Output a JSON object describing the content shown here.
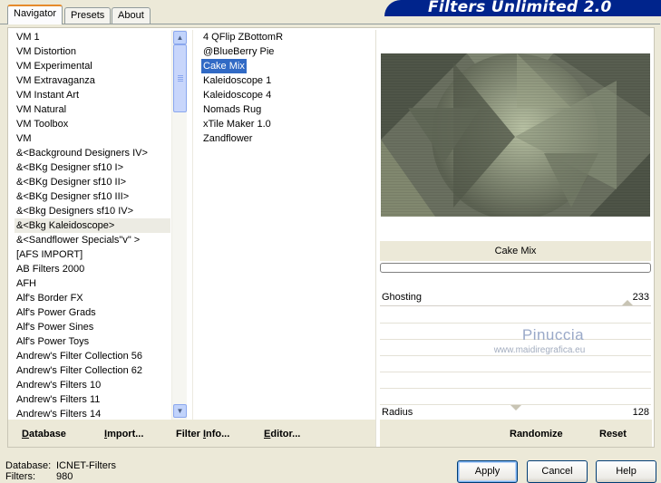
{
  "tabs": [
    {
      "label": "Navigator"
    },
    {
      "label": "Presets"
    },
    {
      "label": "About"
    }
  ],
  "banner": {
    "title": "Filters Unlimited 2.0"
  },
  "categories": [
    "VM 1",
    "VM Distortion",
    "VM Experimental",
    "VM Extravaganza",
    "VM Instant Art",
    "VM Natural",
    "VM Toolbox",
    "VM",
    "&<Background Designers IV>",
    "&<BKg Designer sf10 I>",
    "&<BKg Designer sf10 II>",
    "&<BKg Designer sf10 III>",
    "&<Bkg Designers sf10 IV>",
    "&<Bkg Kaleidoscope>",
    "&<Sandflower Specials\"v\" >",
    "[AFS IMPORT]",
    "AB Filters 2000",
    "AFH",
    "Alf's Border FX",
    "Alf's Power Grads",
    "Alf's Power Sines",
    "Alf's Power Toys",
    "Andrew's Filter Collection 56",
    "Andrew's Filter Collection 62",
    "Andrew's Filters 10",
    "Andrew's Filters 11",
    "Andrew's Filters 14"
  ],
  "filters": [
    "4 QFlip ZBottomR",
    "@BlueBerry Pie",
    "Cake Mix",
    "Kaleidoscope 1",
    "Kaleidoscope 4",
    "Nomads Rug",
    "xTile Maker 1.0",
    "Zandflower"
  ],
  "selected_filter": "Cake Mix",
  "selected_category": "&<Bkg Kaleidoscope>",
  "preview": {
    "filter_name": "Cake Mix"
  },
  "sliders": [
    {
      "label": "Ghosting",
      "value": "233",
      "fraction": 0.914
    },
    {
      "label": "Radius",
      "value": "128",
      "fraction": 0.502
    }
  ],
  "watermark": {
    "line1": "Pinuccia",
    "line2": "www.maidiregrafica.eu"
  },
  "bottom_left": {
    "database": {
      "prefix": "",
      "hot": "D",
      "rest": "atabase"
    },
    "import": {
      "prefix": "",
      "hot": "I",
      "rest": "mport..."
    },
    "filter_info": {
      "prefix": "Filter ",
      "hot": "I",
      "rest": "nfo..."
    },
    "editor": {
      "prefix": "",
      "hot": "E",
      "rest": "ditor..."
    }
  },
  "bottom_right": {
    "randomize": "Randomize",
    "reset": "Reset"
  },
  "status": {
    "database_label": "Database:",
    "database_value": "ICNET-Filters",
    "filters_label": "Filters:",
    "filters_value": "980"
  },
  "buttons": {
    "apply": "Apply",
    "cancel": "Cancel",
    "help": "Help"
  },
  "colors": {
    "selection": "#316ac5",
    "banner": "#00248c",
    "tab_accent": "#e68b2c"
  }
}
